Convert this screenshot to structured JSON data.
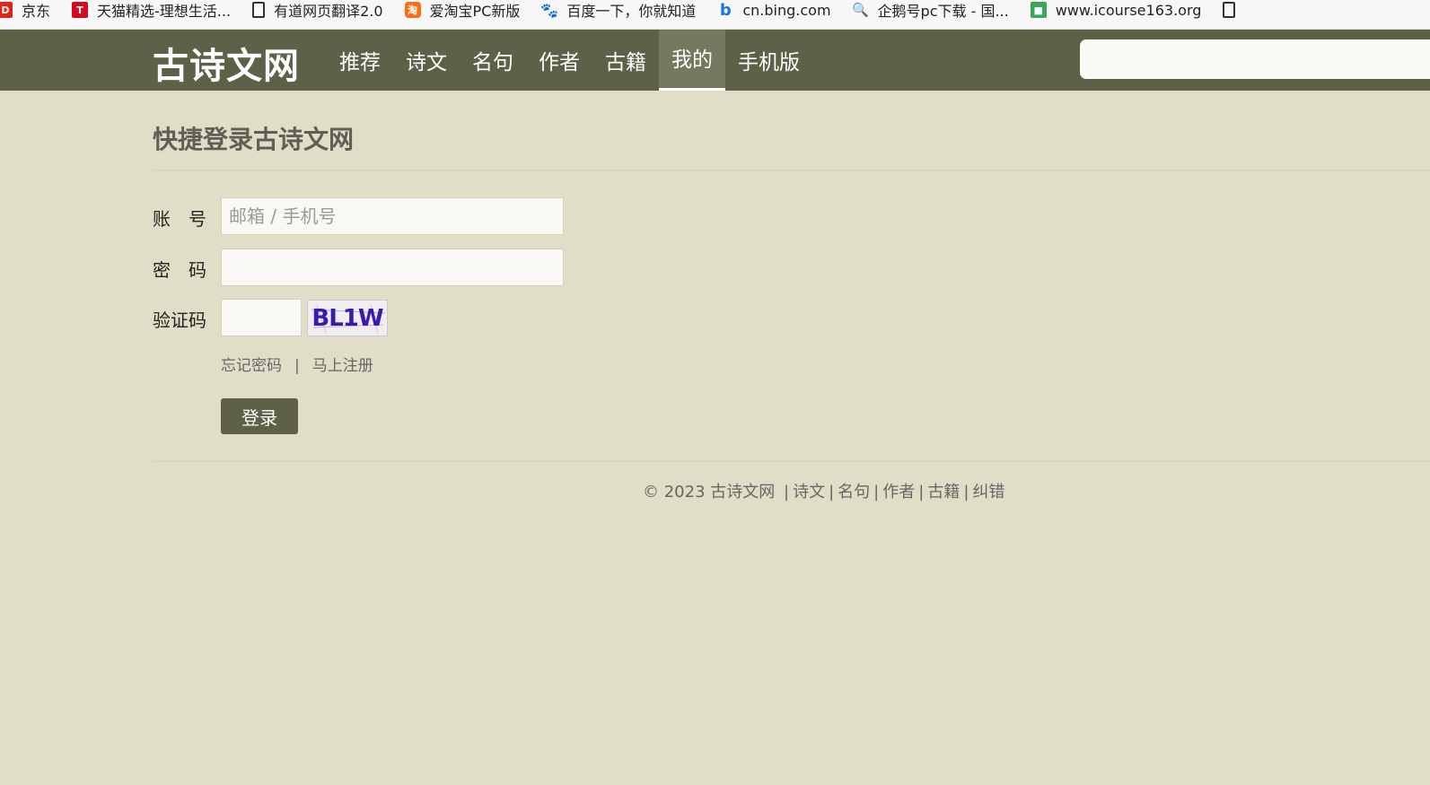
{
  "bookmarks": [
    {
      "label": "京东",
      "icon": "jd-icon",
      "glyph": "D"
    },
    {
      "label": "天猫精选-理想生活...",
      "icon": "tmall-icon",
      "glyph": "T"
    },
    {
      "label": "有道网页翻译2.0",
      "icon": "page-icon",
      "glyph": ""
    },
    {
      "label": "爱淘宝PC新版",
      "icon": "aitaobao-icon",
      "glyph": "淘"
    },
    {
      "label": "百度一下，你就知道",
      "icon": "baidu-icon",
      "glyph": "🐾"
    },
    {
      "label": "cn.bing.com",
      "icon": "bing-icon",
      "glyph": "b"
    },
    {
      "label": "企鹅号pc下载 - 国...",
      "icon": "search-icon",
      "glyph": "🔍"
    },
    {
      "label": "www.icourse163.org",
      "icon": "icourse-icon",
      "glyph": "■"
    },
    {
      "label": "",
      "icon": "page-icon",
      "glyph": ""
    }
  ],
  "header": {
    "logo": "古诗文网",
    "nav": [
      "推荐",
      "诗文",
      "名句",
      "作者",
      "古籍",
      "我的",
      "手机版"
    ],
    "active_nav": "我的",
    "search_value": ""
  },
  "login": {
    "title": "快捷登录古诗文网",
    "account_label": "账　号",
    "account_placeholder": "邮箱 / 手机号",
    "account_value": "",
    "password_label": "密　码",
    "password_value": "",
    "captcha_label": "验证码",
    "captcha_value": "",
    "captcha_image_text": "BL1W",
    "forgot_password": "忘记密码",
    "separator": "|",
    "register": "马上注册",
    "submit": "登录"
  },
  "footer": {
    "copyright": "© 2023 古诗文网",
    "links": [
      "诗文",
      "名句",
      "作者",
      "古籍",
      "纠错"
    ],
    "separator": "|"
  },
  "colors": {
    "page_bg": "#e0dec6",
    "header_bg": "#5e6047",
    "active_nav_bg": "#767860",
    "button_bg": "#5e6047"
  }
}
